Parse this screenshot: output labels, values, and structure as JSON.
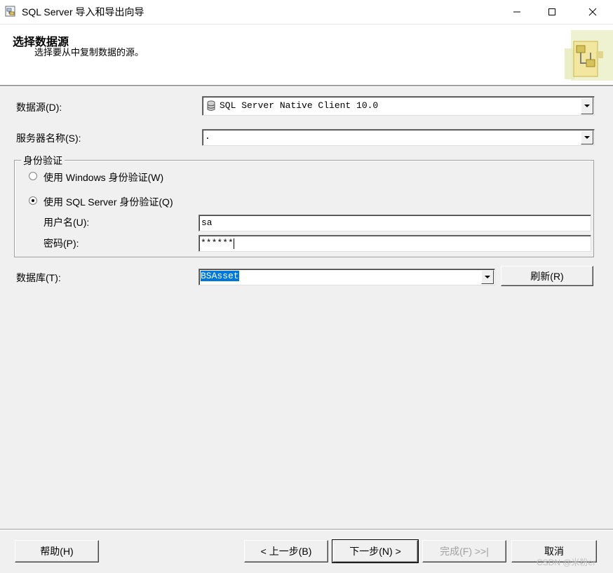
{
  "window": {
    "title": "SQL Server 导入和导出向导",
    "minimize_symbol": "—",
    "maximize_symbol": "☐",
    "close_symbol": "✕"
  },
  "header": {
    "title": "选择数据源",
    "subtitle": "选择要从中复制数据的源。"
  },
  "form": {
    "data_source_label": "数据源(D):",
    "data_source_value": "SQL Server Native Client 10.0",
    "server_name_label": "服务器名称(S):",
    "server_name_value": ".",
    "auth_group_label": "身份验证",
    "auth_windows_label": "使用 Windows 身份验证(W)",
    "auth_sql_label": "使用 SQL Server 身份验证(Q)",
    "auth_selected": "sql",
    "username_label": "用户名(U):",
    "username_value": "sa",
    "password_label": "密码(P):",
    "password_value": "******",
    "database_label": "数据库(T):",
    "database_value": "BSAsset",
    "refresh_label": "刷新(R)"
  },
  "footer": {
    "help_label": "帮助(H)",
    "back_label": "< 上一步(B)",
    "next_label": "下一步(N) >",
    "finish_label": "完成(F) >>|",
    "cancel_label": "取消"
  },
  "watermark": "CSDN @米粉er"
}
